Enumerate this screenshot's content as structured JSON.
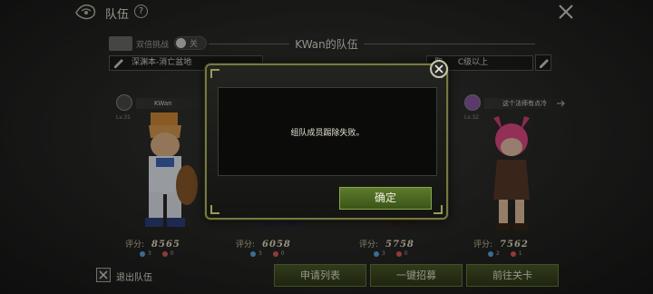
{
  "header": {
    "title": "队伍",
    "help": "?"
  },
  "team": {
    "title": "KWan的队伍",
    "double_challenge_label": "双倍挑战",
    "double_challenge_state": "关",
    "dungeon": "深渊本-消亡盆地",
    "requirement_prefix": "取",
    "requirement": "C级以上"
  },
  "members": [
    {
      "name": "KWan",
      "level": "Lv.31",
      "score_label": "评分:",
      "score": "8565",
      "stat_a": "3",
      "stat_b": "0"
    },
    {
      "name": "",
      "level": "",
      "score_label": "评分:",
      "score": "6058",
      "stat_a": "3",
      "stat_b": "0"
    },
    {
      "name": "",
      "level": "",
      "score_label": "评分:",
      "score": "5758",
      "stat_a": "3",
      "stat_b": "0"
    },
    {
      "name": "这个法师有点冷",
      "level": "Lv.32",
      "score_label": "评分:",
      "score": "7562",
      "stat_a": "2",
      "stat_b": "1"
    }
  ],
  "footer": {
    "exit_label": "退出队伍",
    "apply_list": "申请列表",
    "recruit": "一键招募",
    "go_stage": "前往关卡"
  },
  "dialog": {
    "message": "组队成员踢除失败。",
    "ok": "确定"
  },
  "colors": {
    "accent_green": "#4a5a2a",
    "modal_border": "#77783f",
    "score_text": "#e6dfc0"
  }
}
